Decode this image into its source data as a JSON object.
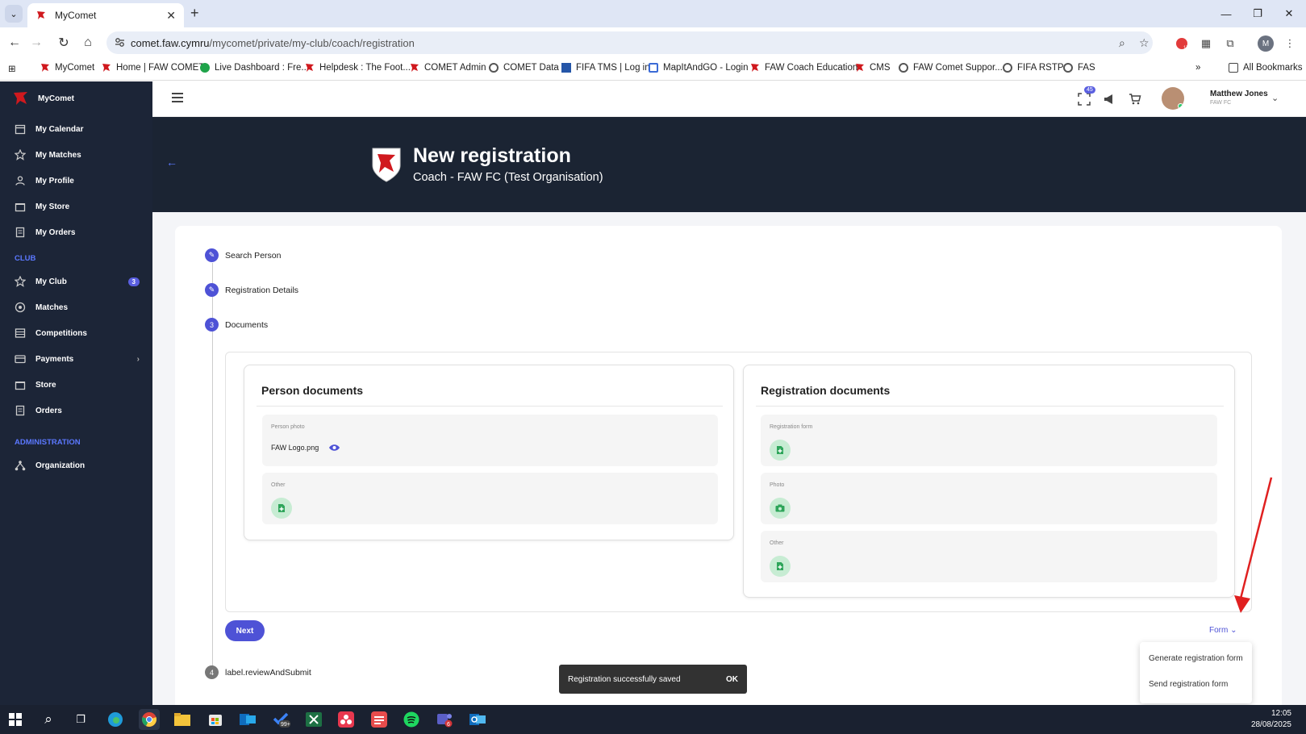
{
  "browser": {
    "tab_title": "MyComet",
    "url_host": "comet.faw.cymru",
    "url_path": "/mycomet/private/my-club/coach/registration",
    "bookmarks": [
      "MyComet",
      "Home | FAW COMET",
      "Live Dashboard : Fre...",
      "Helpdesk : The Foot...",
      "COMET Admin",
      "COMET Data",
      "FIFA TMS | Log in",
      "MapItAndGO - Login",
      "FAW Coach Education",
      "CMS",
      "FAW Comet Suppor...",
      "FIFA RSTP",
      "FAS"
    ],
    "all_bookmarks": "All Bookmarks",
    "ext_badge": "17",
    "profile_initial": "M"
  },
  "sidebar": {
    "brand": "MyComet",
    "items": [
      {
        "label": "My Calendar",
        "icon": "calendar-icon"
      },
      {
        "label": "My Matches",
        "icon": "star-icon"
      },
      {
        "label": "My Profile",
        "icon": "person-icon"
      },
      {
        "label": "My Store",
        "icon": "store-icon"
      },
      {
        "label": "My Orders",
        "icon": "orders-icon"
      }
    ],
    "club_section": "CLUB",
    "club_items": [
      {
        "label": "My Club",
        "icon": "star-icon",
        "badge": "3"
      },
      {
        "label": "Matches",
        "icon": "ball-icon"
      },
      {
        "label": "Competitions",
        "icon": "list-icon"
      },
      {
        "label": "Payments",
        "icon": "card-icon"
      },
      {
        "label": "Store",
        "icon": "store-icon"
      },
      {
        "label": "Orders",
        "icon": "orders-icon"
      }
    ],
    "admin_section": "ADMINISTRATION",
    "admin_items": [
      {
        "label": "Organization",
        "icon": "org-icon"
      }
    ]
  },
  "topbar": {
    "notif_count": "45",
    "user_name": "Matthew Jones",
    "user_org": "FAW FC"
  },
  "hero": {
    "title": "New registration",
    "subtitle": "Coach - FAW FC (Test Organisation)"
  },
  "steps": [
    {
      "label": "Search Person",
      "state": "done"
    },
    {
      "label": "Registration Details",
      "state": "done"
    },
    {
      "number": "3",
      "label": "Documents",
      "state": "active"
    },
    {
      "number": "4",
      "label": "label.reviewAndSubmit",
      "state": "pending"
    }
  ],
  "person_documents": {
    "title": "Person documents",
    "photo_label": "Person photo",
    "photo_file": "FAW Logo.png",
    "other_label": "Other"
  },
  "registration_documents": {
    "title": "Registration documents",
    "form_label": "Registration form",
    "photo_label": "Photo",
    "other_label": "Other"
  },
  "actions": {
    "next": "Next",
    "form": "Form"
  },
  "form_menu": [
    "Generate registration form",
    "Send registration form"
  ],
  "snackbar": {
    "message": "Registration successfully saved",
    "action": "OK"
  },
  "taskbar": {
    "time": "12:05",
    "date": "28/08/2025",
    "badge_a": "99+",
    "badge_b": "6"
  },
  "colors": {
    "accent": "#4e52d6",
    "sidebar": "#1c2537",
    "hero": "#1b2433",
    "upload": "#c7ecd3"
  }
}
